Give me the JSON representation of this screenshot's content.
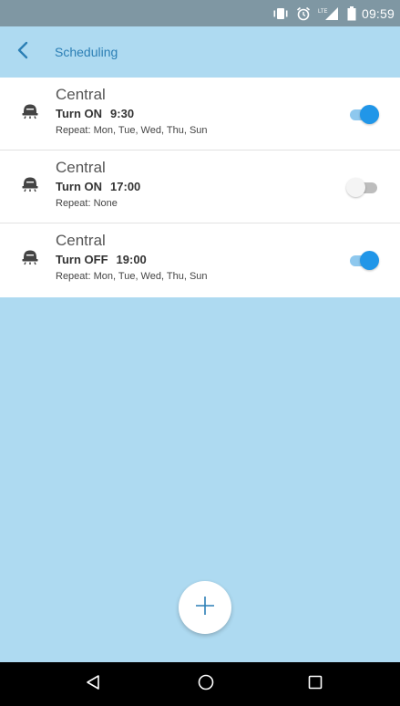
{
  "status_bar": {
    "time": "09:59",
    "icons": [
      "vibrate-icon",
      "alarm-icon",
      "signal-icon",
      "battery-icon"
    ],
    "signal_label": "LTE"
  },
  "app_bar": {
    "title": "Scheduling",
    "back_icon": "chevron-left-icon"
  },
  "schedules": [
    {
      "device": "Central",
      "action": "Turn ON",
      "time": "9:30",
      "repeat": "Repeat: Mon, Tue, Wed, Thu, Sun",
      "enabled": true
    },
    {
      "device": "Central",
      "action": "Turn ON",
      "time": "17:00",
      "repeat": "Repeat: None",
      "enabled": false
    },
    {
      "device": "Central",
      "action": "Turn OFF",
      "time": "19:00",
      "repeat": "Repeat: Mon, Tue, Wed, Thu, Sun",
      "enabled": true
    }
  ],
  "fab": {
    "icon": "plus-icon"
  },
  "nav_bar": {
    "icons": [
      "back-triangle-icon",
      "home-circle-icon",
      "recents-square-icon"
    ]
  },
  "colors": {
    "background": "#aedaf1",
    "status_bar": "#7f97a3",
    "accent": "#2196e8",
    "title": "#2c7fb5"
  }
}
